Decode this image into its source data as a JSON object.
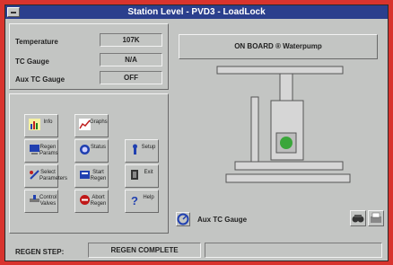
{
  "window": {
    "title": "Station Level - PVD3 - LoadLock"
  },
  "readings": [
    {
      "label": "Temperature",
      "value": "107K"
    },
    {
      "label": "TC Gauge",
      "value": "N/A"
    },
    {
      "label": "Aux TC Gauge",
      "value": "OFF"
    }
  ],
  "buttons": [
    {
      "label": "Info",
      "icon": "chart-icon"
    },
    {
      "label": "Graphs",
      "icon": "graph-icon"
    },
    {
      "label": "Regen Params",
      "icon": "computer-icon"
    },
    {
      "label": "Status",
      "icon": "status-icon"
    },
    {
      "label": "Setup",
      "icon": "wrench-icon"
    },
    {
      "label": "Select Parameters",
      "icon": "params-icon"
    },
    {
      "label": "Start Regen",
      "icon": "start-icon"
    },
    {
      "label": "Exit",
      "icon": "exit-icon"
    },
    {
      "label": "Control Valves",
      "icon": "valve-icon"
    },
    {
      "label": "Abort Regen",
      "icon": "stop-icon"
    },
    {
      "label": "Help",
      "icon": "help-icon"
    }
  ],
  "onboard_status": "ON BOARD ® Waterpump",
  "aux_tc": {
    "label": "Aux TC Gauge"
  },
  "regen": {
    "label": "REGEN STEP:",
    "value": "REGEN COMPLETE"
  },
  "colors": {
    "titlebar": "#2b3f8d",
    "desktop": "#d8342e",
    "led": "#3aa63a",
    "window": "#c3c5c3"
  }
}
